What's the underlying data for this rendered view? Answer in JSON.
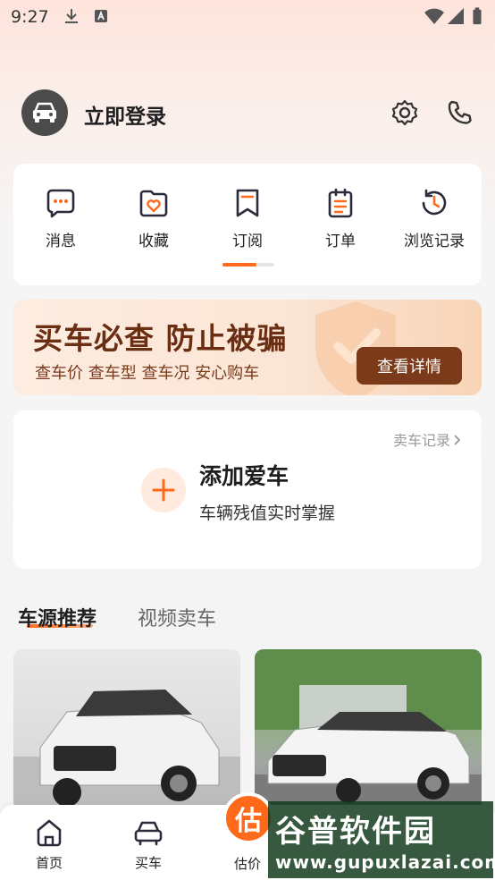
{
  "status_bar": {
    "time": "9:27"
  },
  "header": {
    "login_label": "立即登录"
  },
  "quick_menu": [
    {
      "label": "消息",
      "icon": "message-icon"
    },
    {
      "label": "收藏",
      "icon": "favorite-icon"
    },
    {
      "label": "订阅",
      "icon": "subscribe-icon"
    },
    {
      "label": "订单",
      "icon": "order-icon"
    },
    {
      "label": "浏览记录",
      "icon": "history-icon"
    }
  ],
  "banner": {
    "title": "买车必查 防止被骗",
    "subtitle": "查车价 查车型 查车况 安心购车",
    "button": "查看详情"
  },
  "add_car": {
    "sell_record": "卖车记录",
    "title": "添加爱车",
    "subtitle": "车辆残值实时掌握"
  },
  "feed_tabs": {
    "active": "车源推荐",
    "inactive": "视频卖车"
  },
  "bottom_nav": {
    "home": "首页",
    "buy": "买车",
    "estimate_icon_text": "估",
    "estimate": "估价"
  },
  "watermark": {
    "title": "谷普软件园",
    "url": "www.gupuxlazai.com"
  },
  "colors": {
    "accent": "#ff6a1a",
    "banner_button": "#7b3a1a"
  }
}
